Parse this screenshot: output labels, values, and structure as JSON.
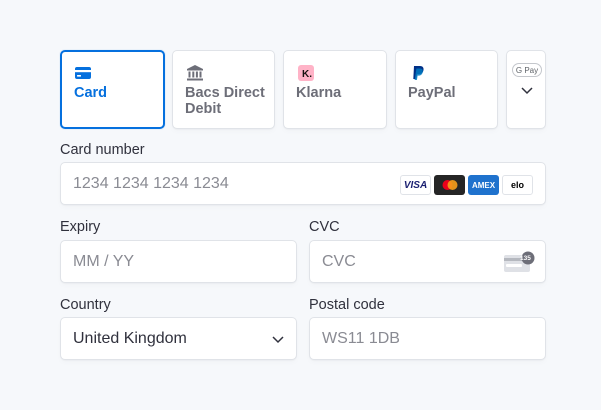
{
  "tabs": [
    {
      "label": "Card",
      "icon": "card-icon",
      "selected": true
    },
    {
      "label": "Bacs Direct Debit",
      "icon": "bank-icon",
      "selected": false
    },
    {
      "label": "Klarna",
      "icon": "klarna-logo-icon",
      "selected": false
    },
    {
      "label": "PayPal",
      "icon": "paypal-logo-icon",
      "selected": false
    },
    {
      "label": "G Pay",
      "icon": "google-pay-logo-icon",
      "selected": false
    }
  ],
  "card_number": {
    "label": "Card number",
    "placeholder": "1234 1234 1234 1234",
    "brands": [
      "VISA",
      "Mastercard",
      "AMEX",
      "elo"
    ]
  },
  "expiry": {
    "label": "Expiry",
    "placeholder": "MM / YY"
  },
  "cvc": {
    "label": "CVC",
    "placeholder": "CVC",
    "badge": "135"
  },
  "country": {
    "label": "Country",
    "value": "United Kingdom"
  },
  "postal": {
    "label": "Postal code",
    "placeholder": "WS11 1DB"
  },
  "colors": {
    "accent": "#0570de",
    "background": "#f6f8fb",
    "border": "#e0e3e8"
  }
}
